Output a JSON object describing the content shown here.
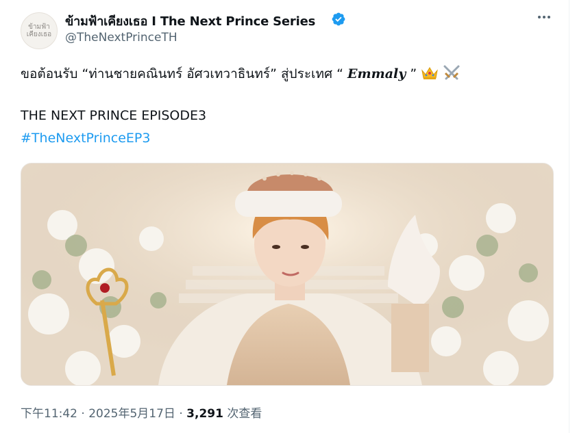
{
  "account": {
    "avatar_text": "ข้ามฟ้า\nเคียงเธอ",
    "display_name": "ข้ามฟ้าเคียงเธอ I The Next Prince Series",
    "handle": "@TheNextPrinceTH"
  },
  "tweet": {
    "line1_prefix": "ขอต้อนรับ “ท่านชายคณินทร์ อัศวเทวาธินทร์” สู่ประเทศ “ ",
    "line1_emmaly": "Emmaly",
    "line1_suffix": " ”",
    "line2": "THE NEXT PRINCE EPISODE3",
    "hashtag": "#TheNextPrinceEP3"
  },
  "meta": {
    "time": "下午11:42",
    "separator1": " · ",
    "date": "2025年5月17日",
    "separator2": " · ",
    "views_count": "3,291",
    "views_label": " 次查看"
  },
  "icons": {
    "verified": "verified-badge-icon",
    "more": "more-options-icon",
    "crown": "crown-emoji-icon",
    "swords": "crossed-swords-emoji-icon"
  },
  "colors": {
    "link": "#1d9bf0",
    "secondary_text": "#536471",
    "verified": "#1d9bf0"
  }
}
